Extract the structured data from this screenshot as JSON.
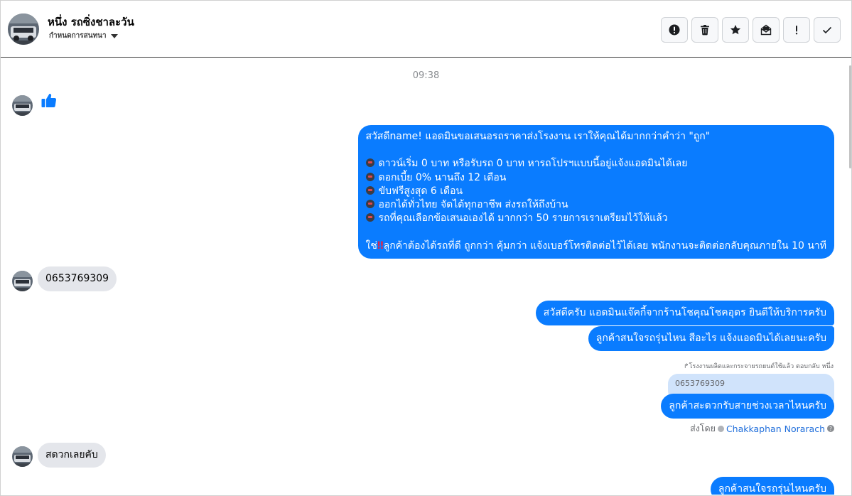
{
  "header": {
    "contact_name": "หนึ่ง รถซิ่งชาละวัน",
    "assign_label": "กำหนดการสนทนา",
    "toolbar": [
      {
        "name": "spam-button",
        "icon": "alert-circle-icon"
      },
      {
        "name": "delete-button",
        "icon": "trash-icon"
      },
      {
        "name": "star-button",
        "icon": "star-icon"
      },
      {
        "name": "mark-unread-button",
        "icon": "envelope-open-icon"
      },
      {
        "name": "priority-button",
        "icon": "exclamation-icon"
      },
      {
        "name": "done-button",
        "icon": "check-icon"
      }
    ]
  },
  "conversation": {
    "timestamp": "09:38",
    "msg_like": "thumbs-up-icon",
    "msg_promo": {
      "line1": "สวัสดีname! แอดมินขอเสนอรถราคาส่งโรงงาน เราให้คุณได้มากกว่าคำว่า \"ถูก\"",
      "b1": "ดาวน์เริ่ม 0 บาท หรือรับรถ 0 บาท หารถโปรฯแบบนี้อยู่แจ้งแอดมินได้เลย",
      "b2": "ดอกเบี้ย 0% นานถึง 12 เดือน",
      "b3": "ขับฟรีสูงสุด 6 เดือน",
      "b4": "ออกได้ทั่วไทย จัดได้ทุกอาชีพ ส่งรถให้ถึงบ้าน",
      "b5": "รถที่คุณเลือกข้อเสนอเองได้ มากกว่า 50 รายการเราเตรียมไว้ให้แล้ว",
      "closing_prefix": "ใช่",
      "closing_mark": "‼",
      "closing_rest": "ลูกค้าต้องได้รถที่ดี ถูกกว่า คุ้มกว่า แจ้งเบอร์โทรติดต่อไว้ได้เลย พนักงานจะติดต่อกลับคุณภายใน 10 นาที"
    },
    "msg_phone": "0653769309",
    "msg_greet": "สวัสดีครับ แอดมินแจ๊คกี้จากร้านโชคุณโชคอุดร ยินดีให้บริการครับ",
    "msg_ask_model": "ลูกค้าสนใจรถรุ่นไหน สีอะไร แจ้งแอดมินได้เลยนะครับ",
    "reply_meta": "โรงงานผลิตและกระจายรถยนต์ใช้แล้ว ตอบกลับ หนึ่ง",
    "quoted_text": "0653769309",
    "msg_ask_time": "ลูกค้าสะดวกรับสายช่วงเวลาไหนครับ",
    "sent_by_label": "ส่งโดย",
    "sent_by_agent": "Chakkaphan Norarach",
    "msg_convenient": "สดวกเลยคับ",
    "msg_partial": "ลูกค้าสนใจรถรุ่นไหนครับ"
  },
  "colors": {
    "outgoing": "#0a7cff",
    "incoming": "#e4e6eb",
    "quote": "#d0e3fb",
    "link": "#216fdb"
  }
}
